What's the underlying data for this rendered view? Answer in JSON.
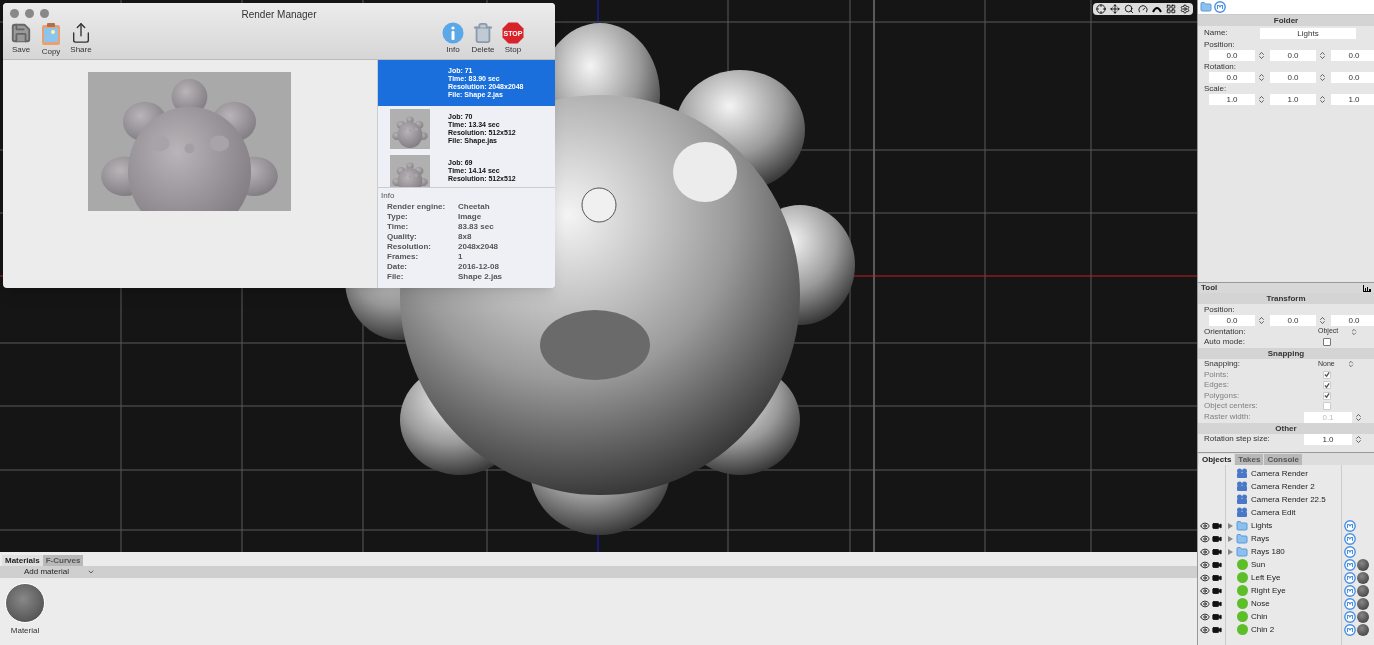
{
  "render_manager": {
    "title": "Render Manager",
    "toolbar_left": [
      {
        "kind": "save",
        "label": "Save"
      },
      {
        "kind": "copy",
        "label": "Copy"
      },
      {
        "kind": "share",
        "label": "Share"
      }
    ],
    "toolbar_right": [
      {
        "kind": "info",
        "label": "Info"
      },
      {
        "kind": "delete",
        "label": "Delete"
      },
      {
        "kind": "stop",
        "label": "Stop"
      }
    ],
    "stop_sign_text": "STOP",
    "jobs": [
      {
        "selected": true,
        "thumbnail": false,
        "lines": [
          "Job: 71",
          "Time: 83.90 sec",
          "Resolution: 2048x2048",
          "File: Shape 2.jas"
        ]
      },
      {
        "selected": false,
        "thumbnail": true,
        "lines": [
          "Job: 70",
          "Time: 13.34 sec",
          "Resolution: 512x512",
          "File: Shape.jas"
        ]
      },
      {
        "selected": false,
        "thumbnail": true,
        "lines": [
          "Job: 69",
          "Time: 14.14 sec",
          "Resolution: 512x512"
        ]
      }
    ],
    "info": {
      "title": "Info",
      "rows": [
        {
          "label": "Render engine:",
          "value": "Cheetah"
        },
        {
          "label": "Type:",
          "value": "Image"
        },
        {
          "label": "Time:",
          "value": "83.83 sec"
        },
        {
          "label": "Quality:",
          "value": "8x8"
        },
        {
          "label": "Resolution:",
          "value": "2048x2048"
        },
        {
          "label": "Frames:",
          "value": "1"
        },
        {
          "label": "Date:",
          "value": "2016-12-08"
        },
        {
          "label": "File:",
          "value": "Shape 2.jas"
        }
      ]
    }
  },
  "folder_panel": {
    "title": "Folder",
    "name_label": "Name:",
    "name_value": "Lights",
    "vectors": [
      {
        "label": "Position:",
        "values": [
          "0.0",
          "0.0",
          "0.0"
        ]
      },
      {
        "label": "Rotation:",
        "values": [
          "0.0",
          "0.0",
          "0.0"
        ]
      },
      {
        "label": "Scale:",
        "values": [
          "1.0",
          "1.0",
          "1.0"
        ]
      }
    ]
  },
  "tool_panel": {
    "title": "Tool",
    "rows": [
      {
        "kind": "section",
        "label": "Transform"
      },
      {
        "kind": "vector",
        "label": "Position:",
        "values": [
          "0.0",
          "0.0",
          "0.0"
        ]
      },
      {
        "kind": "select",
        "label": "Orientation:",
        "value": "Object"
      },
      {
        "kind": "checkbox",
        "label": "Auto mode:",
        "checked": false,
        "disabled": false
      },
      {
        "kind": "section",
        "label": "Snapping"
      },
      {
        "kind": "select",
        "label": "Snapping:",
        "value": "None"
      },
      {
        "kind": "checkbox",
        "label": "Points:",
        "checked": true,
        "disabled": true
      },
      {
        "kind": "checkbox",
        "label": "Edges:",
        "checked": true,
        "disabled": true
      },
      {
        "kind": "checkbox",
        "label": "Polygons:",
        "checked": true,
        "disabled": true
      },
      {
        "kind": "checkbox",
        "label": "Object centers:",
        "checked": false,
        "disabled": true
      },
      {
        "kind": "number",
        "label": "Raster width:",
        "value": "0.1",
        "disabled": true
      },
      {
        "kind": "section",
        "label": "Other"
      },
      {
        "kind": "number",
        "label": "Rotation step size:",
        "value": "1.0",
        "disabled": false
      }
    ]
  },
  "objects_panel": {
    "tabs": [
      {
        "label": "Objects",
        "selected": true
      },
      {
        "label": "Takes",
        "selected": false
      },
      {
        "label": "Console",
        "selected": false
      }
    ],
    "items": [
      {
        "kind": "camera",
        "name": "Camera Render"
      },
      {
        "kind": "camera",
        "name": "Camera Render 2"
      },
      {
        "kind": "camera",
        "name": "Camera Render 22.5"
      },
      {
        "kind": "camera",
        "name": "Camera Edit"
      },
      {
        "kind": "folder",
        "name": "Lights"
      },
      {
        "kind": "folder",
        "name": "Rays"
      },
      {
        "kind": "folder",
        "name": "Rays 180"
      },
      {
        "kind": "object",
        "name": "Sun"
      },
      {
        "kind": "object",
        "name": "Left Eye"
      },
      {
        "kind": "object",
        "name": "Right Eye"
      },
      {
        "kind": "object",
        "name": "Nose"
      },
      {
        "kind": "object",
        "name": "Chin"
      },
      {
        "kind": "object",
        "name": "Chin 2"
      }
    ]
  },
  "materials_panel": {
    "tabs": [
      {
        "label": "Materials",
        "selected": true
      },
      {
        "label": "F-Curves",
        "selected": false
      }
    ],
    "add_material": "Add material",
    "materials": [
      {
        "name": "Material"
      }
    ]
  }
}
